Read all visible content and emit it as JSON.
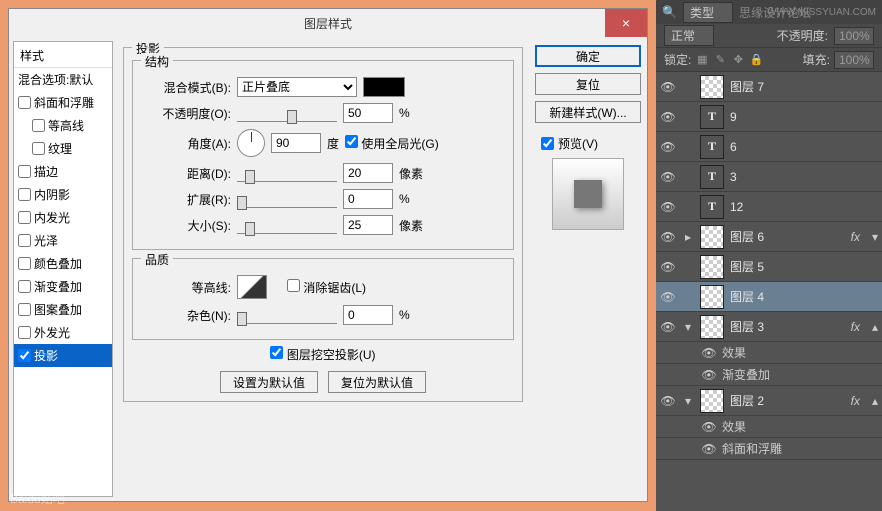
{
  "dialog": {
    "title": "图层样式",
    "close": "×",
    "styles_header": "样式",
    "blend_options": "混合选项:默认",
    "style_items": [
      {
        "label": "斜面和浮雕",
        "checked": false
      },
      {
        "label": "等高线",
        "checked": false,
        "indent": true
      },
      {
        "label": "纹理",
        "checked": false,
        "indent": true
      },
      {
        "label": "描边",
        "checked": false
      },
      {
        "label": "内阴影",
        "checked": false
      },
      {
        "label": "内发光",
        "checked": false
      },
      {
        "label": "光泽",
        "checked": false
      },
      {
        "label": "颜色叠加",
        "checked": false
      },
      {
        "label": "渐变叠加",
        "checked": false
      },
      {
        "label": "图案叠加",
        "checked": false
      },
      {
        "label": "外发光",
        "checked": false
      },
      {
        "label": "投影",
        "checked": true,
        "selected": true
      }
    ],
    "section": {
      "title": "投影",
      "structure": "结构",
      "blend_mode_label": "混合模式(B):",
      "blend_mode_value": "正片叠底",
      "opacity_label": "不透明度(O):",
      "opacity_value": "50",
      "pct": "%",
      "angle_label": "角度(A):",
      "angle_value": "90",
      "degree": "度",
      "global_light": "使用全局光(G)",
      "distance_label": "距离(D):",
      "distance_value": "20",
      "px": "像素",
      "spread_label": "扩展(R):",
      "spread_value": "0",
      "size_label": "大小(S):",
      "size_value": "25",
      "quality": "品质",
      "contour_label": "等高线:",
      "antialias": "消除锯齿(L)",
      "noise_label": "杂色(N):",
      "noise_value": "0",
      "knockout": "图层挖空投影(U)",
      "make_default": "设置为默认值",
      "reset_default": "复位为默认值"
    },
    "right": {
      "ok": "确定",
      "cancel": "复位",
      "new_style": "新建样式(W)...",
      "preview": "预览(V)"
    }
  },
  "panels": {
    "search_icon": "🔍",
    "type_label": "类型",
    "watermark": "WWW.MISSYUAN.COM",
    "forum": "思缘设计论坛",
    "mode": "正常",
    "opacity_label": "不透明度:",
    "opacity_value": "100%",
    "lock_label": "锁定:",
    "fill_label": "填充:",
    "fill_value": "100%",
    "layers": [
      {
        "type": "raster",
        "name": "图层 7"
      },
      {
        "type": "text",
        "name": "9"
      },
      {
        "type": "text",
        "name": "6"
      },
      {
        "type": "text",
        "name": "3"
      },
      {
        "type": "text",
        "name": "12"
      },
      {
        "type": "raster",
        "name": "图层 6",
        "fx": true
      },
      {
        "type": "raster",
        "name": "图层 5"
      },
      {
        "type": "raster",
        "name": "图层 4",
        "selected": true
      },
      {
        "type": "raster",
        "name": "图层 3",
        "fx": true,
        "expanded": true,
        "effects": [
          "效果",
          "渐变叠加"
        ]
      },
      {
        "type": "raster",
        "name": "图层 2",
        "fx": true,
        "expanded": true,
        "effects": [
          "效果",
          "斜面和浮雕"
        ]
      }
    ]
  },
  "baidu": "Baidu贴吧"
}
